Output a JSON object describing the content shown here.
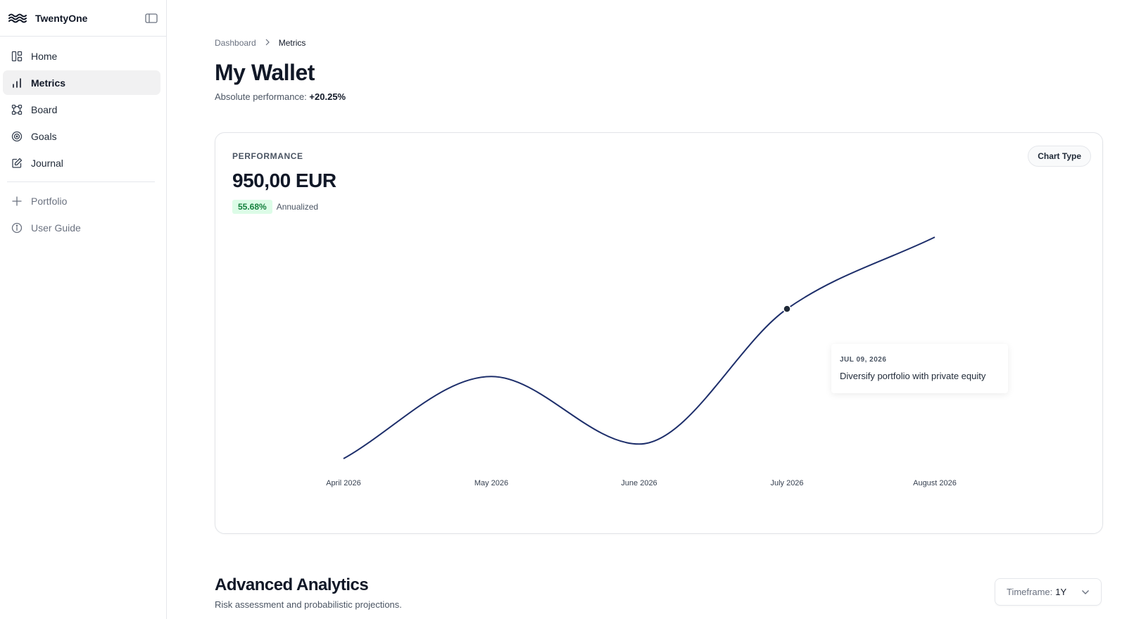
{
  "app": {
    "name": "TwentyOne"
  },
  "sidebar": {
    "items": [
      {
        "label": "Home",
        "icon": "layout-icon",
        "active": false
      },
      {
        "label": "Metrics",
        "icon": "bar-chart-icon",
        "active": true
      },
      {
        "label": "Board",
        "icon": "board-icon",
        "active": false
      },
      {
        "label": "Goals",
        "icon": "target-icon",
        "active": false
      },
      {
        "label": "Journal",
        "icon": "edit-icon",
        "active": false
      }
    ],
    "secondary": [
      {
        "label": "Portfolio",
        "icon": "plus-icon"
      },
      {
        "label": "User Guide",
        "icon": "info-icon"
      }
    ]
  },
  "breadcrumb": {
    "parent": "Dashboard",
    "current": "Metrics"
  },
  "page": {
    "title": "My Wallet",
    "performance_label": "Absolute performance:",
    "performance_value": "+20.25%"
  },
  "card": {
    "label": "PERFORMANCE",
    "amount": "950,00 EUR",
    "badge": "55.68%",
    "badge_note": "Annualized",
    "chart_type_button": "Chart Type",
    "tooltip": {
      "date": "JUL 09, 2026",
      "text": "Diversify portfolio with private equity"
    }
  },
  "chart_data": {
    "type": "line",
    "title": "",
    "xlabel": "",
    "ylabel": "",
    "x": [
      "April 2026",
      "May 2026",
      "June 2026",
      "July 2026",
      "August 2026"
    ],
    "series": [
      {
        "values": [
          0,
          0.79,
          0.14,
          1.44,
          2.13
        ]
      }
    ],
    "highlight": {
      "date": "JUL 09, 2026",
      "value": 1.44
    },
    "ylim": [
      0,
      2.3
    ],
    "grid": false,
    "legend": "none",
    "line_color": "#1e2f6b"
  },
  "analytics": {
    "title": "Advanced Analytics",
    "subtitle": "Risk assessment and probabilistic projections.",
    "timeframe_label": "Timeframe:",
    "timeframe_value": "1Y"
  },
  "colors": {
    "accent": "#1e2f6b",
    "badge_bg": "#dcfce7",
    "badge_text": "#15803d",
    "active_nav": "#f1f1f2"
  }
}
